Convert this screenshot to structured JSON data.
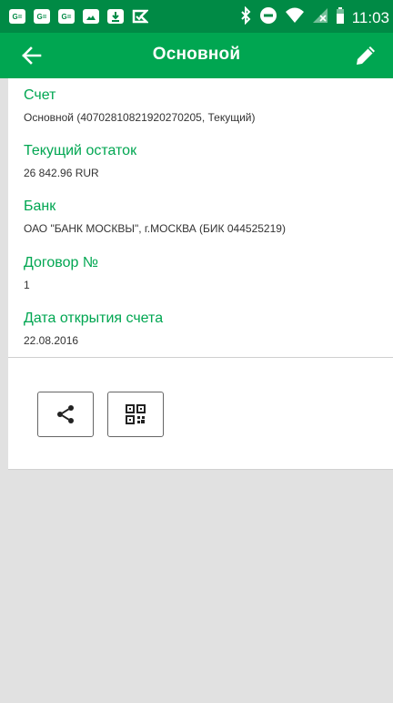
{
  "status_bar": {
    "time": "11:03",
    "left_icons": [
      "gmail-icon",
      "gmail-icon",
      "gmail-icon",
      "image-icon",
      "download-icon",
      "check-icon"
    ],
    "right_icons": [
      "bluetooth-icon",
      "do-not-disturb-icon",
      "wifi-icon",
      "no-signal-icon",
      "battery-icon"
    ]
  },
  "app_bar": {
    "title": "Основной"
  },
  "fields": [
    {
      "label": "Счет",
      "value": "Основной (40702810821920270205, Текущий)"
    },
    {
      "label": "Текущий остаток",
      "value": "26 842.96 RUR"
    },
    {
      "label": "Банк",
      "value": "ОАО \"БАНК МОСКВЫ\", г.МОСКВА (БИК 044525219)"
    },
    {
      "label": "Договор №",
      "value": "1"
    },
    {
      "label": "Дата открытия счета",
      "value": "22.08.2016"
    }
  ],
  "actions": {
    "share_icon": "share-icon",
    "qr_icon": "qr-code-icon"
  },
  "colors": {
    "status_bar": "#008a45",
    "app_bar": "#00a651",
    "label": "#00a651",
    "background": "#e1e1e1"
  }
}
